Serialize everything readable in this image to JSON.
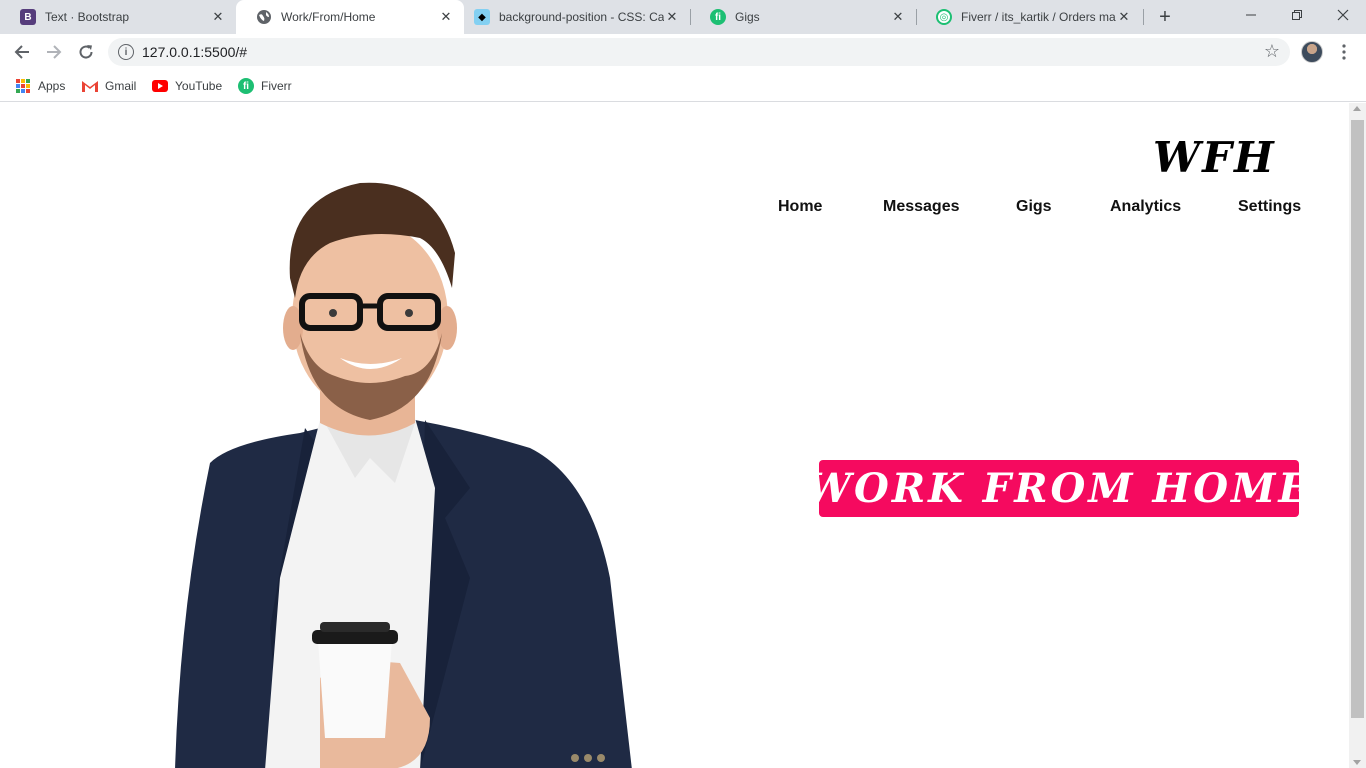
{
  "browser": {
    "tabs": [
      {
        "title": "Text · Bootstrap",
        "icon": "bootstrap-icon",
        "active": false
      },
      {
        "title": "Work/From/Home",
        "icon": "globe-icon",
        "active": true
      },
      {
        "title": "background-position - CSS: Ca",
        "icon": "mdn-icon",
        "active": false
      },
      {
        "title": "Gigs",
        "icon": "fiverr-icon",
        "active": false
      },
      {
        "title": "Fiverr / its_kartik / Orders man",
        "icon": "fiverr-ring-icon",
        "active": false
      }
    ],
    "tab_close_glyph": "✕",
    "new_tab_glyph": "+",
    "url": "127.0.0.1:5500/#",
    "bookmarks": [
      {
        "label": "Apps",
        "icon": "apps-grid-icon"
      },
      {
        "label": "Gmail",
        "icon": "gmail-icon"
      },
      {
        "label": "YouTube",
        "icon": "youtube-icon"
      },
      {
        "label": "Fiverr",
        "icon": "fiverr-icon"
      }
    ]
  },
  "site": {
    "logo": "WFH",
    "nav": [
      {
        "label": "Home"
      },
      {
        "label": "Messages"
      },
      {
        "label": "Gigs"
      },
      {
        "label": "Analytics"
      },
      {
        "label": "Settings"
      }
    ],
    "hero_text": "WORK FROM HOME",
    "colors": {
      "accent": "#f50a5f",
      "text": "#111111"
    }
  }
}
